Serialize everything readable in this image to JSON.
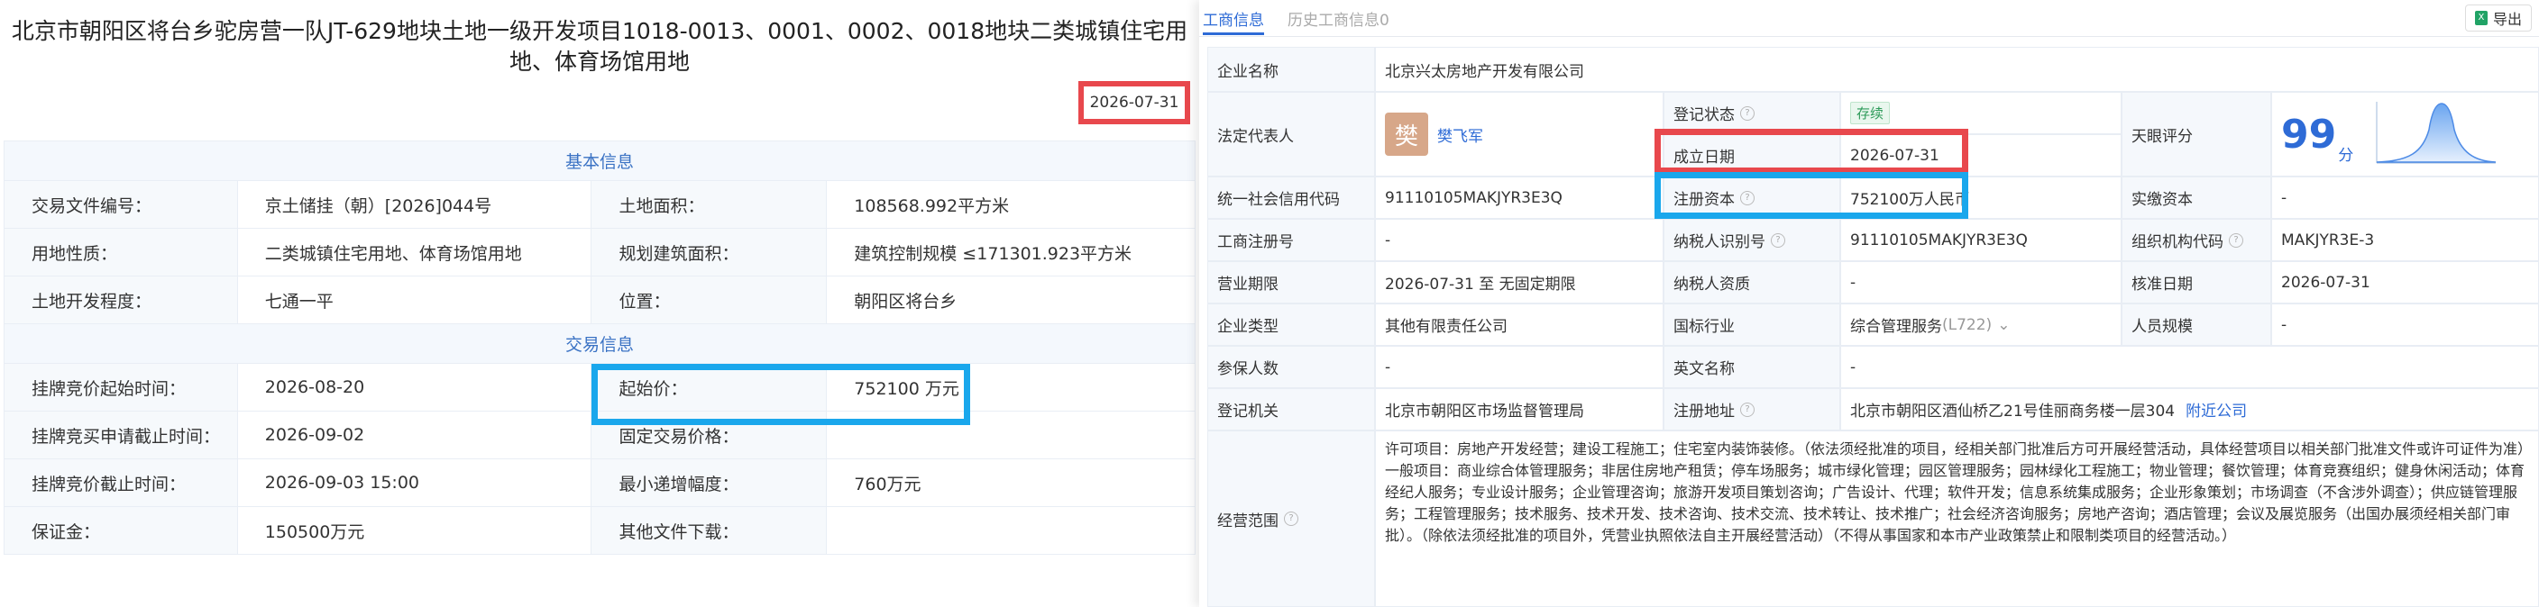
{
  "left": {
    "title": "北京市朝阳区将台乡驼房营一队JT-629地块土地一级开发项目1018-0013、0001、0002、0018地块二类城镇住宅用地、体育场馆用地",
    "date": "2026-07-31",
    "section_basic": "基本信息",
    "section_trade": "交易信息",
    "rows": {
      "doc_no_label": "交易文件编号：",
      "doc_no": "京土储挂（朝）[2026]044号",
      "area_label": "土地面积：",
      "area": "108568.992平方米",
      "use_label": "用地性质：",
      "use": "二类城镇住宅用地、体育场馆用地",
      "build_label": "规划建筑面积：",
      "build": "建筑控制规模 ≤171301.923平方米",
      "level_label": "土地开发程度：",
      "level": "七通一平",
      "loc_label": "位置：",
      "loc": "朝阳区将台乡",
      "start_time_label": "挂牌竞价起始时间：",
      "start_time": "2026-08-20",
      "start_price_label": "起始价：",
      "start_price": "752100 万元",
      "apply_end_label": "挂牌竞买申请截止时间：",
      "apply_end": "2026-09-02",
      "fixed_price_label": "固定交易价格：",
      "fixed_price": "",
      "bid_end_label": "挂牌竞价截止时间：",
      "bid_end": "2026-09-03 15:00",
      "min_inc_label": "最小递增幅度：",
      "min_inc": "760万元",
      "deposit_label": "保证金：",
      "deposit": "150500万元",
      "other_files_label": "其他文件下载：",
      "other_files": ""
    }
  },
  "right": {
    "tab_active": "工商信息",
    "tab_history": "历史工商信息0",
    "export_label": "导出",
    "company_name_label": "企业名称",
    "company_name": "北京兴太房地产开发有限公司",
    "legal_rep_label": "法定代表人",
    "legal_rep_avatar": "樊",
    "legal_rep": "樊飞军",
    "reg_status_label": "登记状态",
    "reg_status": "存续",
    "found_date_label": "成立日期",
    "found_date": "2026-07-31",
    "tianyan_label": "天眼评分",
    "tianyan_score": "99",
    "tianyan_unit": "分",
    "credit_code_label": "统一社会信用代码",
    "credit_code": "91110105MAKJYR3E3Q",
    "reg_capital_label": "注册资本",
    "reg_capital": "752100万人民币",
    "paid_capital_label": "实缴资本",
    "paid_capital": "-",
    "biz_reg_no_label": "工商注册号",
    "biz_reg_no": "-",
    "taxpayer_id_label": "纳税人识别号",
    "taxpayer_id": "91110105MAKJYR3E3Q",
    "org_code_label": "组织机构代码",
    "org_code": "MAKJYR3E-3",
    "biz_term_label": "营业期限",
    "biz_term": "2026-07-31 至 无固定期限",
    "taxpayer_qual_label": "纳税人资质",
    "taxpayer_qual": "-",
    "approve_date_label": "核准日期",
    "approve_date": "2026-07-31",
    "ent_type_label": "企业类型",
    "ent_type": "其他有限责任公司",
    "industry_label": "国标行业",
    "industry": "综合管理服务",
    "industry_code": "(L722)",
    "staff_size_label": "人员规模",
    "staff_size": "-",
    "insured_label": "参保人数",
    "insured": "-",
    "en_name_label": "英文名称",
    "en_name": "-",
    "reg_authority_label": "登记机关",
    "reg_authority": "北京市朝阳区市场监督管理局",
    "reg_address_label": "注册地址",
    "reg_address": "北京市朝阳区酒仙桥乙21号佳丽商务楼一层304",
    "nearby_link": "附近公司",
    "scope_label": "经营范围",
    "scope": "许可项目：房地产开发经营；建设工程施工；住宅室内装饰装修。（依法须经批准的项目，经相关部门批准后方可开展经营活动，具体经营项目以相关部门批准文件或许可证件为准）一般项目：商业综合体管理服务；非居住房地产租赁；停车场服务；城市绿化管理；园区管理服务；园林绿化工程施工；物业管理；餐饮管理；体育竞赛组织；健身休闲活动；体育经纪人服务；专业设计服务；企业管理咨询；旅游开发项目策划咨询；广告设计、代理；软件开发；信息系统集成服务；企业形象策划；市场调查（不含涉外调查）；供应链管理服务；工程管理服务；技术服务、技术开发、技术咨询、技术交流、技术转让、技术推广；社会经济咨询服务；房地产咨询；酒店管理；会议及展览服务（出国办展须经相关部门审批）。（除依法须经批准的项目外，凭营业执照依法自主开展经营活动）（不得从事国家和本市产业政策禁止和限制类项目的经营活动。）"
  },
  "colors": {
    "accent": "#2e6bd6",
    "red_highlight": "#e8484d",
    "blue_highlight": "#1aa7ec"
  }
}
